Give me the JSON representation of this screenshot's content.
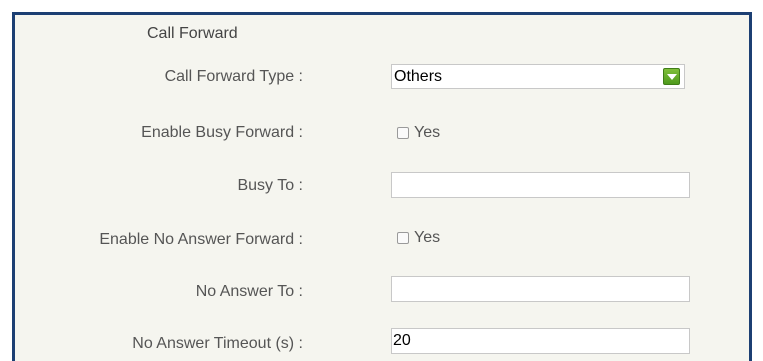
{
  "section": {
    "title": "Call Forward"
  },
  "fields": {
    "call_forward_type": {
      "label": "Call Forward Type :",
      "value": "Others"
    },
    "enable_busy_forward": {
      "label": "Enable Busy Forward :",
      "option_label": "Yes",
      "checked": false
    },
    "busy_to": {
      "label": "Busy To :",
      "value": ""
    },
    "enable_no_answer_forward": {
      "label": "Enable No Answer Forward :",
      "option_label": "Yes",
      "checked": false
    },
    "no_answer_to": {
      "label": "No Answer To :",
      "value": ""
    },
    "no_answer_timeout": {
      "label": "No Answer Timeout (s) :",
      "value": "20"
    }
  },
  "colors": {
    "panel_border": "#1c3f73",
    "panel_background": "#f5f5ef",
    "dropdown_arrow": "#5aa526"
  }
}
